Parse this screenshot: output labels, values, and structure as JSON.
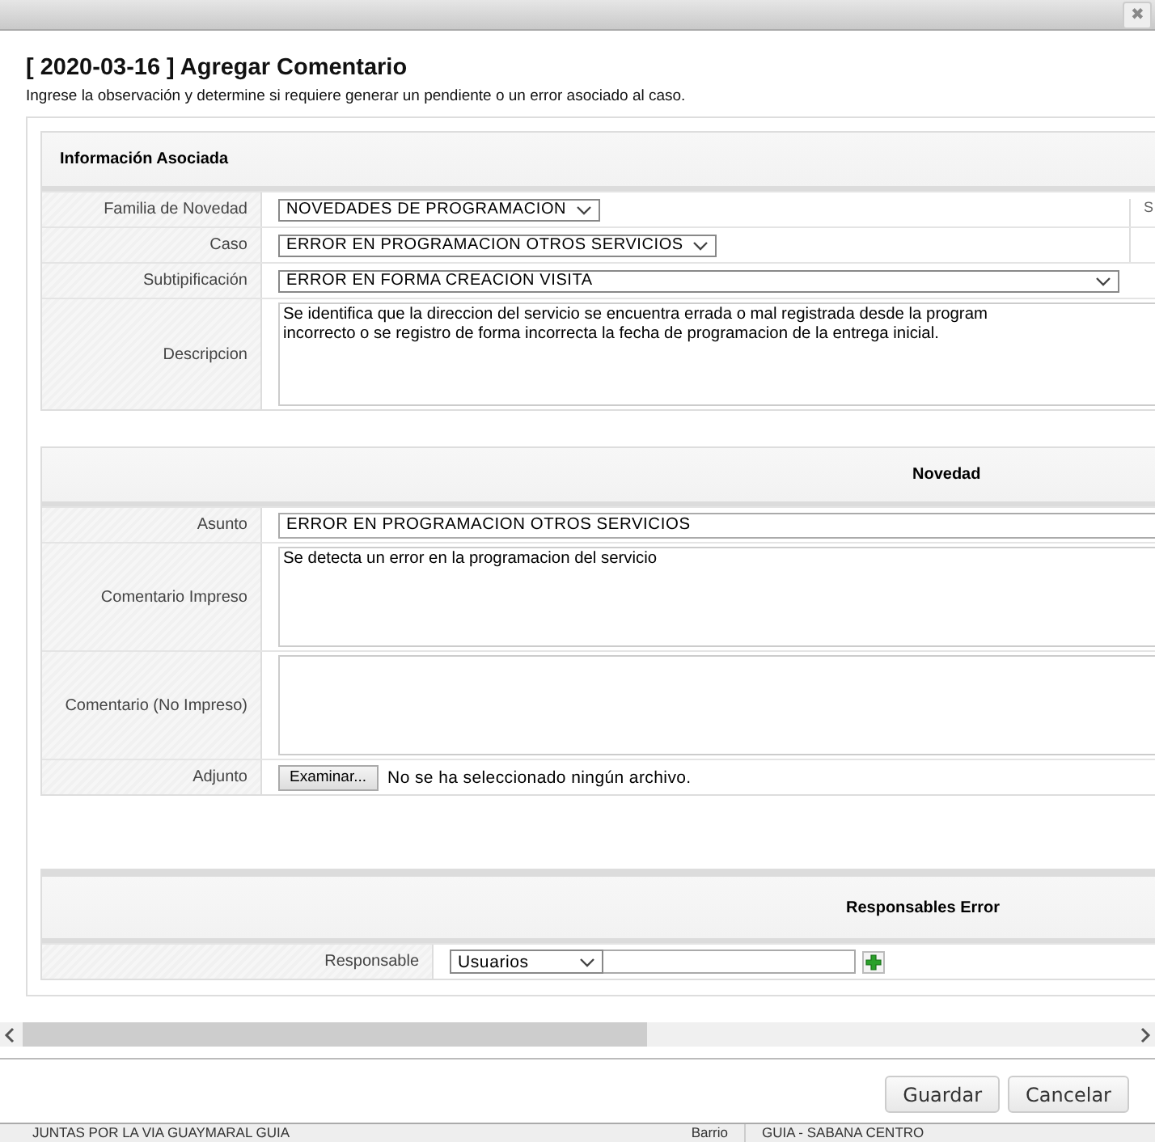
{
  "window": {
    "close_icon": "✖"
  },
  "title": "[ 2020-03-16 ] Agregar Comentario",
  "subtitle": "Ingrese la observación y determine si requiere generar un pendiente o un error asociado al caso.",
  "info_section": {
    "heading": "Información Asociada",
    "column_3": "S",
    "rows": [
      {
        "kind": "select",
        "label": "Familia de Novedad",
        "value": "NOVEDADES DE PROGRAMACION"
      },
      {
        "kind": "select",
        "label": "Caso",
        "value": "ERROR EN PROGRAMACION OTROS SERVICIOS"
      },
      {
        "kind": "select",
        "label": "Subtipificación",
        "value": "ERROR EN FORMA CREACION VISITA"
      },
      {
        "kind": "textarea",
        "label": "Descripcion",
        "lines": [
          "Se identifica que la direccion del servicio se encuentra errada o mal registrada desde la program",
          "incorrecto o se registro de forma incorrecta la fecha de programacion de la entrega inicial."
        ]
      }
    ]
  },
  "novedad_section": {
    "heading": "Novedad",
    "rows": [
      {
        "kind": "input",
        "label": "Asunto",
        "value": "ERROR EN PROGRAMACION OTROS SERVICIOS"
      },
      {
        "kind": "textarea",
        "label": "Comentario Impreso",
        "lines": [
          "Se detecta un error en la programacion del servicio"
        ]
      },
      {
        "kind": "textarea",
        "label": "Comentario (No Impreso)",
        "lines": []
      },
      {
        "kind": "file",
        "label": "Adjunto",
        "button": "Examinar...",
        "status": "No se ha seleccionado ningún archivo."
      }
    ]
  },
  "responsables_section": {
    "heading": "Responsables Error",
    "label": "Responsable",
    "select_value": "Usuarios"
  },
  "buttons": [
    "Guardar",
    "Cancelar"
  ],
  "background_row": [
    "JUNTAS  POR LA VIA GUAYMARAL GUIA",
    "Barrio",
    "GUIA - SABANA CENTRO"
  ]
}
